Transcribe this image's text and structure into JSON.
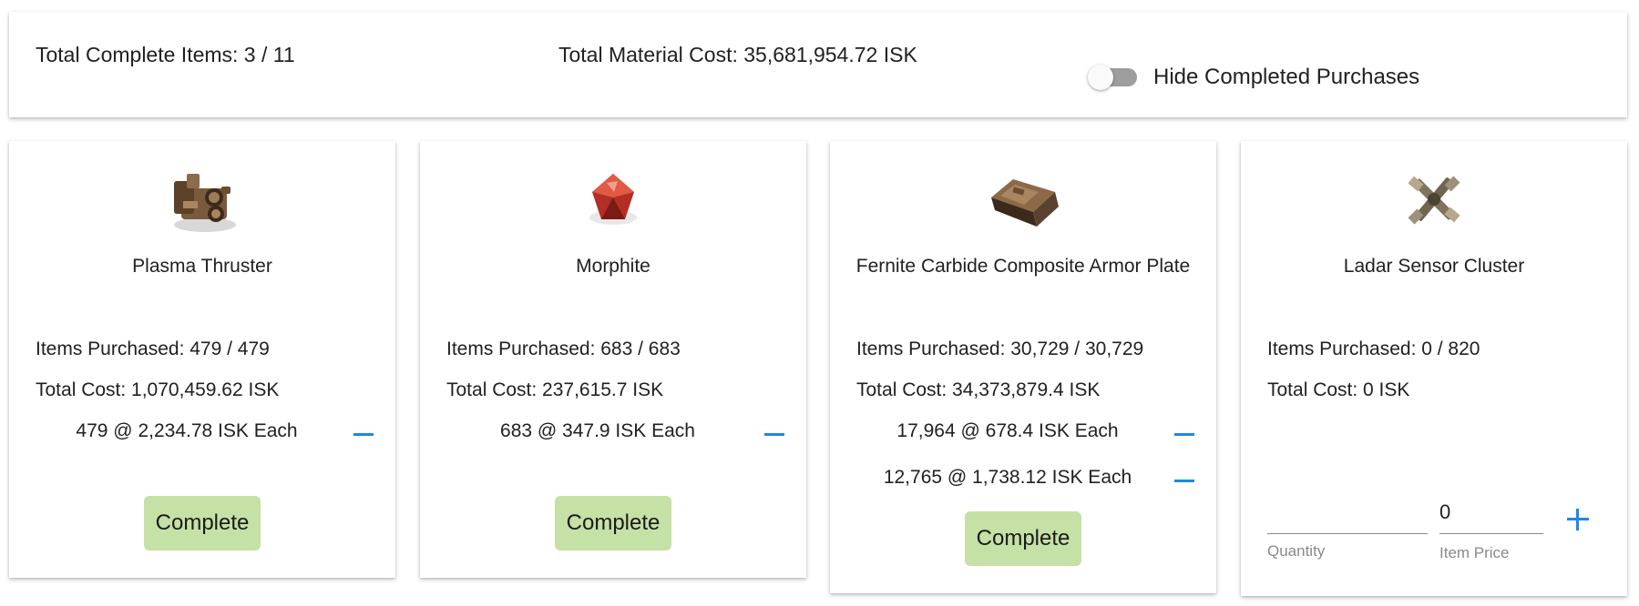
{
  "summary": {
    "complete_items": "Total Complete Items: 3 / 11",
    "material_cost": "Total Material Cost: 35,681,954.72 ISK",
    "hide_completed_label": "Hide Completed Purchases",
    "hide_completed_on": false
  },
  "colors": {
    "accent": "#1e88e5",
    "complete_button": "#c5e1a5",
    "toggle_track": "#9e9e9e"
  },
  "cards": [
    {
      "icon": "plasma-thruster-icon",
      "name": "Plasma Thruster",
      "items_purchased": "Items Purchased: 479 / 479",
      "total_cost": "Total Cost: 1,070,459.62 ISK",
      "purchases": [
        "479 @ 2,234.78 ISK Each"
      ],
      "complete_label": "Complete"
    },
    {
      "icon": "morphite-icon",
      "name": "Morphite",
      "items_purchased": "Items Purchased: 683 / 683",
      "total_cost": "Total Cost: 237,615.7 ISK",
      "purchases": [
        "683 @ 347.9 ISK Each"
      ],
      "complete_label": "Complete"
    },
    {
      "icon": "armor-plate-icon",
      "name": "Fernite Carbide Composite Armor Plate",
      "items_purchased": "Items Purchased: 30,729 / 30,729",
      "total_cost": "Total Cost: 34,373,879.4 ISK",
      "purchases": [
        "17,964 @ 678.4 ISK Each",
        "12,765 @ 1,738.12 ISK Each"
      ],
      "complete_label": "Complete"
    },
    {
      "icon": "sensor-cluster-icon",
      "name": "Ladar Sensor Cluster",
      "items_purchased": "Items Purchased: 0 / 820",
      "total_cost": "Total Cost: 0 ISK",
      "purchases": [],
      "quantity_value": "",
      "quantity_label": "Quantity",
      "price_value": "0",
      "price_label": "Item Price"
    }
  ]
}
